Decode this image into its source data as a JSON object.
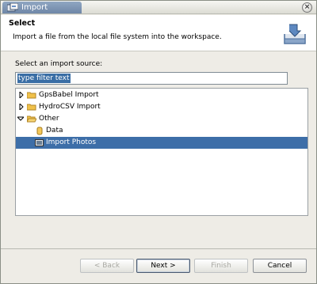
{
  "window": {
    "title": "Import"
  },
  "header": {
    "title": "Select",
    "description": "Import a file from the local file system into the workspace."
  },
  "source": {
    "label": "Select an import source:",
    "filter_value": "type filter text"
  },
  "tree": [
    {
      "label": "GpsBabel Import",
      "expanded": false,
      "type": "folder"
    },
    {
      "label": "HydroCSV Import",
      "expanded": false,
      "type": "folder"
    },
    {
      "label": "Other",
      "expanded": true,
      "type": "folder"
    },
    {
      "label": "Data",
      "type": "leaf",
      "icon": "data-icon"
    },
    {
      "label": "Import Photos",
      "type": "leaf",
      "icon": "photo-icon",
      "selected": true
    }
  ],
  "buttons": {
    "back": "< Back",
    "next": "Next >",
    "finish": "Finish",
    "cancel": "Cancel"
  },
  "colors": {
    "selection": "#3d6ea8",
    "title_tab": "#7a91b0"
  }
}
